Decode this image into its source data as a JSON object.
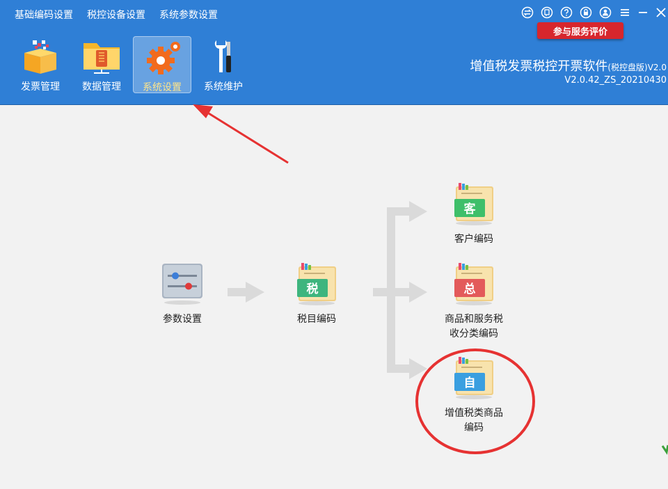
{
  "menu": {
    "items": [
      {
        "label": "基础编码设置"
      },
      {
        "label": "税控设备设置"
      },
      {
        "label": "系统参数设置"
      }
    ]
  },
  "window_controls": [
    {
      "icon": "exchange-icon"
    },
    {
      "icon": "feedback-icon"
    },
    {
      "icon": "help-icon"
    },
    {
      "icon": "lock-icon"
    },
    {
      "icon": "user-icon"
    },
    {
      "icon": "menu-icon"
    },
    {
      "icon": "minimize-icon"
    },
    {
      "icon": "close-icon"
    }
  ],
  "evaluate_button": "参与服务评价",
  "toolbar": {
    "items": [
      {
        "label": "发票管理",
        "active": false
      },
      {
        "label": "数据管理",
        "active": false
      },
      {
        "label": "系统设置",
        "active": true
      },
      {
        "label": "系统维护",
        "active": false
      }
    ]
  },
  "app": {
    "title": "增值税发票税控开票软件",
    "edition": "(税控盘版)V2.0",
    "version": "V2.0.42_ZS_20210430"
  },
  "nodes": {
    "params": {
      "label": "参数设置"
    },
    "tax_code": {
      "label": "税目编码",
      "badge": "税"
    },
    "customer": {
      "label": "客户编码",
      "badge": "客"
    },
    "goods_tax": {
      "label_line1": "商品和服务税",
      "label_line2": "收分类编码",
      "badge": "总"
    },
    "vat_goods": {
      "label_line1": "增值税类商品",
      "label_line2": "编码",
      "badge": "自"
    }
  },
  "colors": {
    "header": "#2f7fd6",
    "accent_red": "#e63232",
    "badge_customer": "#3fbf6a",
    "badge_goods": "#e35a5a",
    "badge_vat": "#3a9fe0",
    "badge_tax": "#3eb57e"
  }
}
